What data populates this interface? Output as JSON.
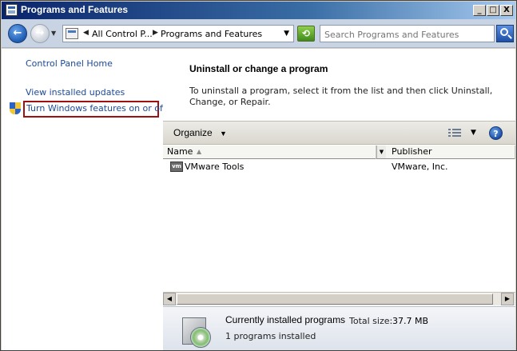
{
  "window": {
    "title": "Programs and Features",
    "controls": {
      "minimize": "_",
      "maximize": "□",
      "close": "X"
    }
  },
  "address": {
    "crumbs": [
      "All Control P...",
      "Programs and Features"
    ],
    "search_placeholder": "Search Programs and Features"
  },
  "sidebar": {
    "links": [
      {
        "label": "Control Panel Home"
      },
      {
        "label": "View installed updates"
      },
      {
        "label": "Turn Windows features on or off",
        "icon": "uac-shield-icon",
        "highlighted": true
      }
    ]
  },
  "main": {
    "heading": "Uninstall or change a program",
    "description": "To uninstall a program, select it from the list and then click Uninstall, Change, or Repair.",
    "toolbar": {
      "organize_label": "Organize"
    },
    "columns": [
      "Name",
      "Publisher"
    ],
    "programs": [
      {
        "icon_text": "vm",
        "name": "VMware Tools",
        "publisher": "VMware, Inc."
      }
    ]
  },
  "details": {
    "title": "Currently installed programs",
    "total_size_label": "Total size:",
    "total_size_value": "37.7 MB",
    "count_text": "1 programs installed"
  },
  "colors": {
    "title_bar_start": "#0a246a",
    "link": "#1a4a9a",
    "highlight_box": "#a01010"
  }
}
